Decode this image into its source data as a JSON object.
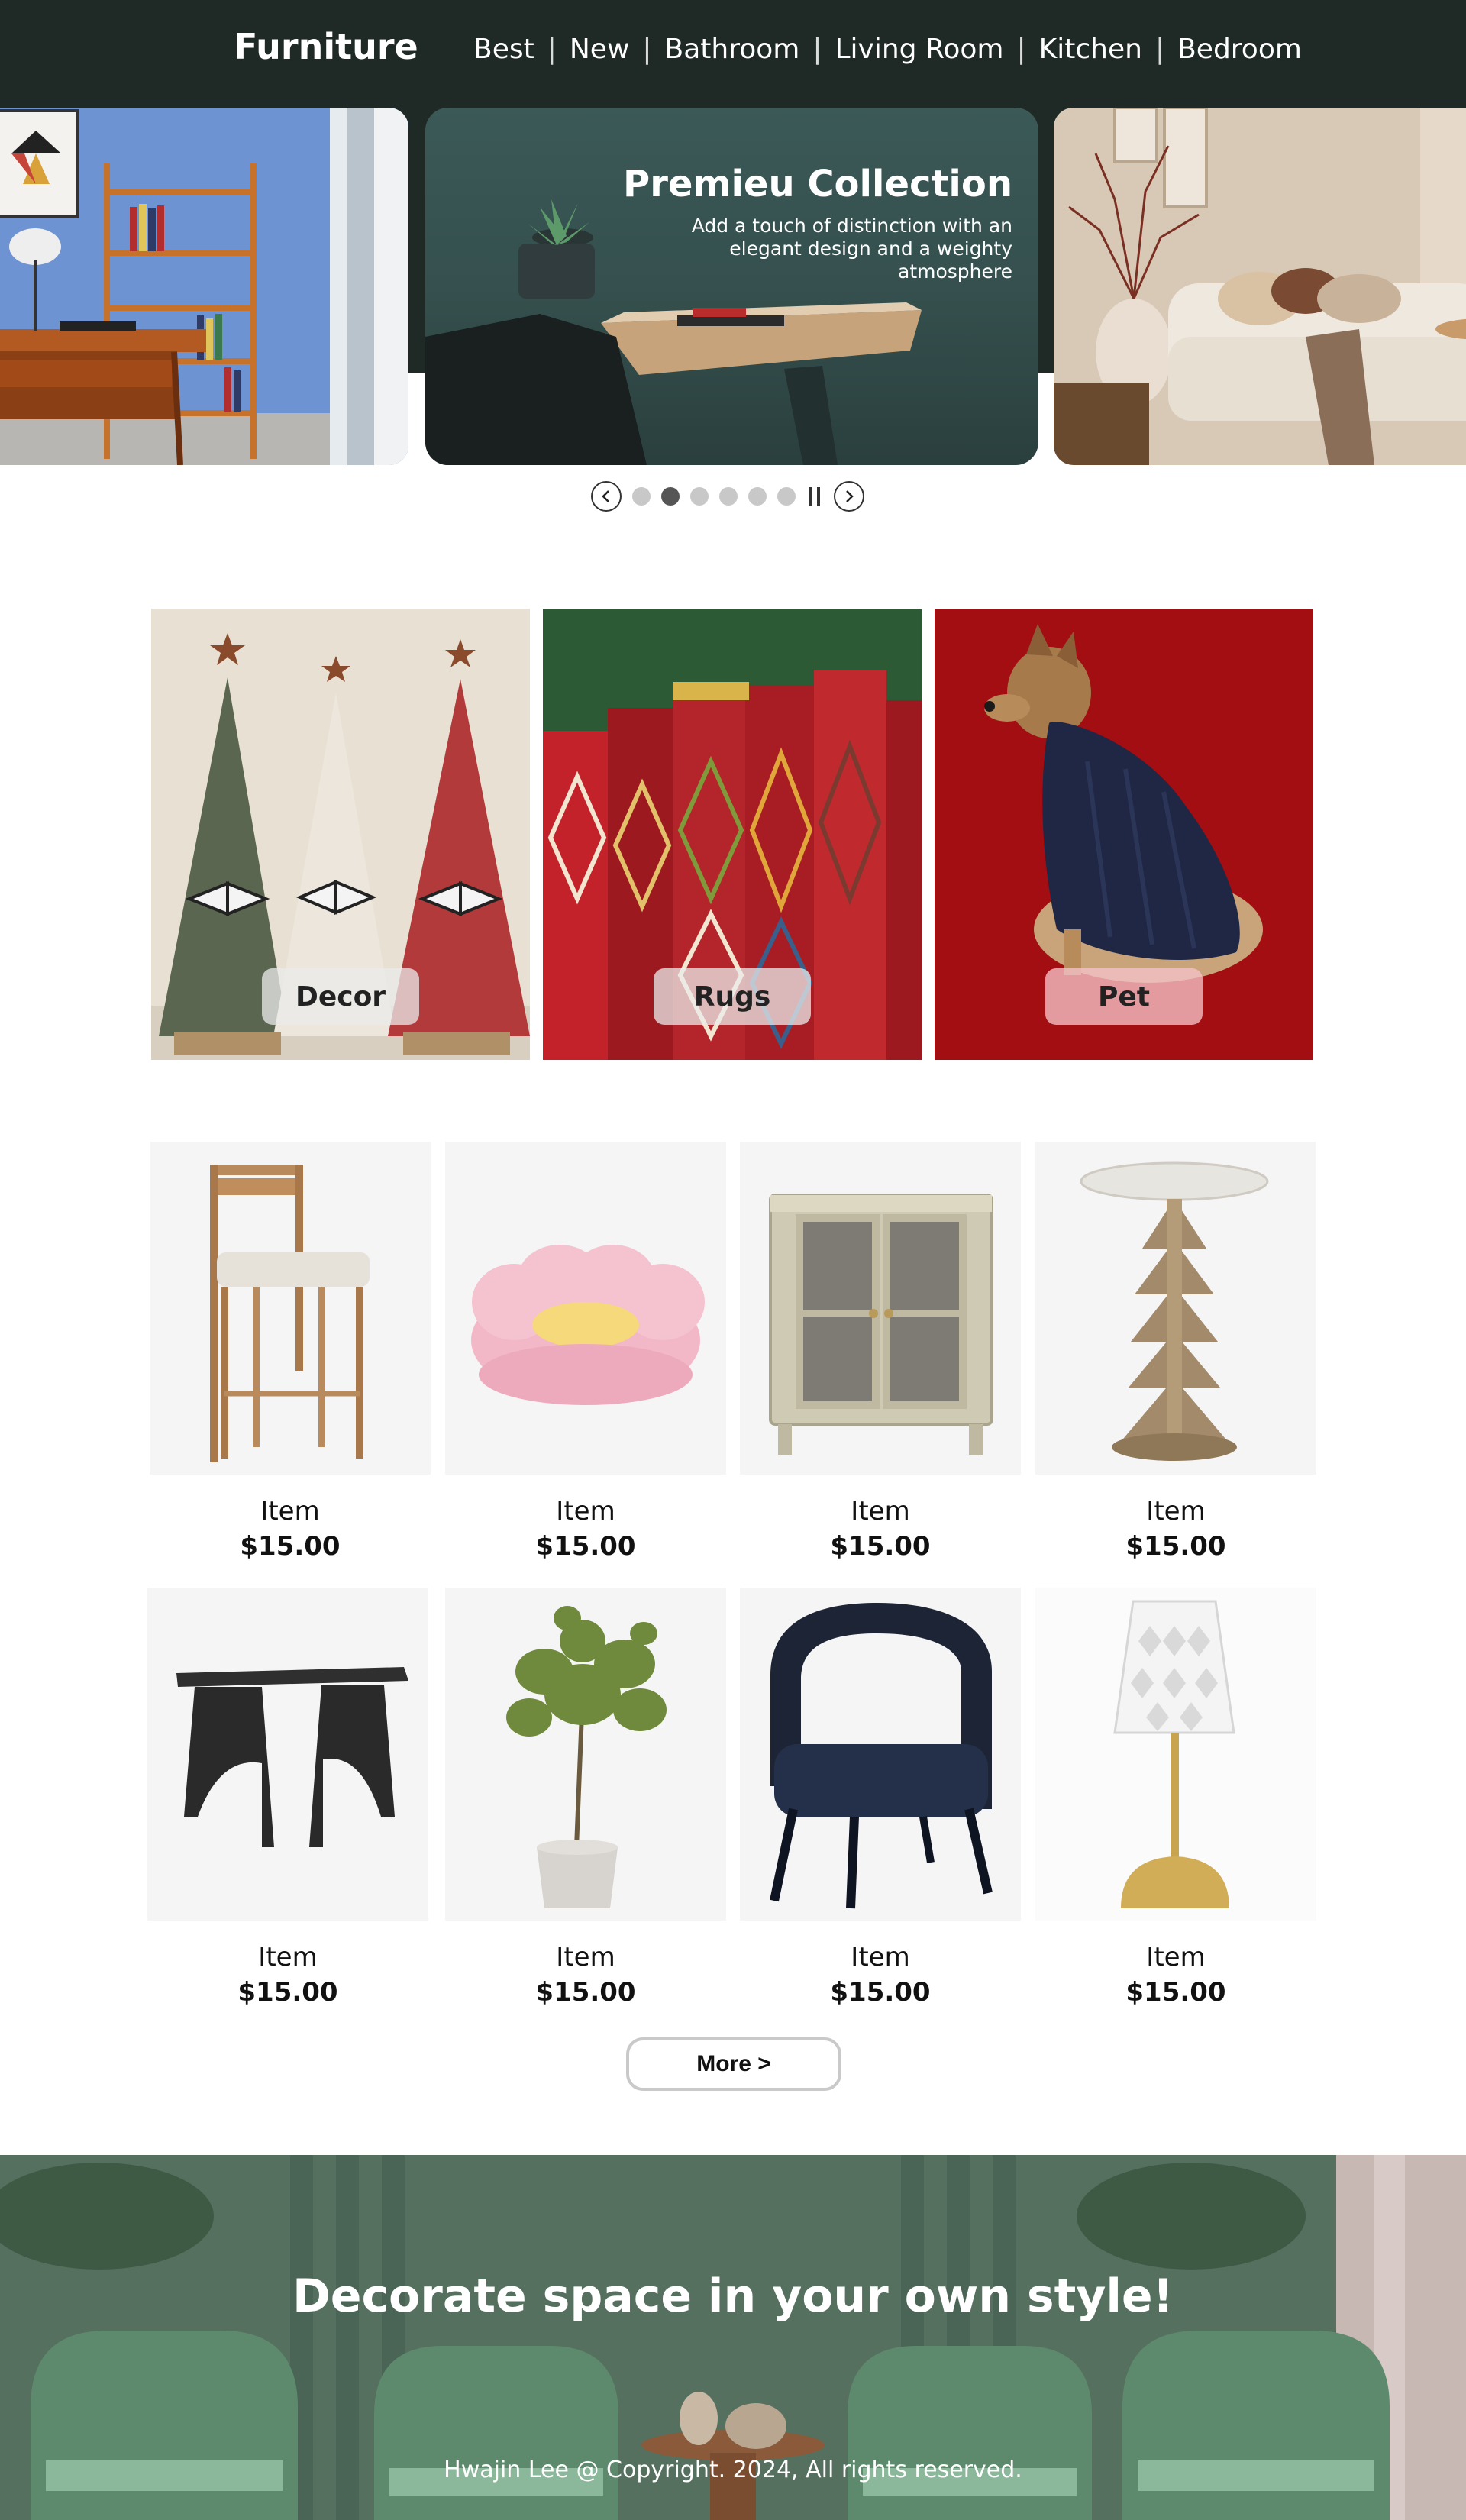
{
  "header": {
    "brand": "Furniture",
    "nav": [
      "Best",
      "New",
      "Bathroom",
      "Living Room",
      "Kitchen",
      "Bedroom"
    ],
    "separator": "|",
    "background": "#1f2a27"
  },
  "hero": {
    "title": "Premieu Collection",
    "subtitle": "Add a touch of distinction with an elegant design and a weighty atmosphere",
    "slide_count": 6,
    "active_slide": 2
  },
  "categories": [
    {
      "label": "Decor"
    },
    {
      "label": "Rugs"
    },
    {
      "label": "Pet"
    }
  ],
  "products": [
    {
      "name": "Item",
      "price": "$15.00"
    },
    {
      "name": "Item",
      "price": "$15.00"
    },
    {
      "name": "Item",
      "price": "$15.00"
    },
    {
      "name": "Item",
      "price": "$15.00"
    },
    {
      "name": "Item",
      "price": "$15.00"
    },
    {
      "name": "Item",
      "price": "$15.00"
    },
    {
      "name": "Item",
      "price": "$15.00"
    },
    {
      "name": "Item",
      "price": "$15.00"
    }
  ],
  "more_button": "More >",
  "footer": {
    "title": "Decorate space in your own style!",
    "copyright": "Hwajin Lee @ Copyright. 2024, All rights reserved."
  },
  "icons": {
    "prev": "chevron-left-icon",
    "next": "chevron-right-icon",
    "pause": "pause-icon"
  }
}
